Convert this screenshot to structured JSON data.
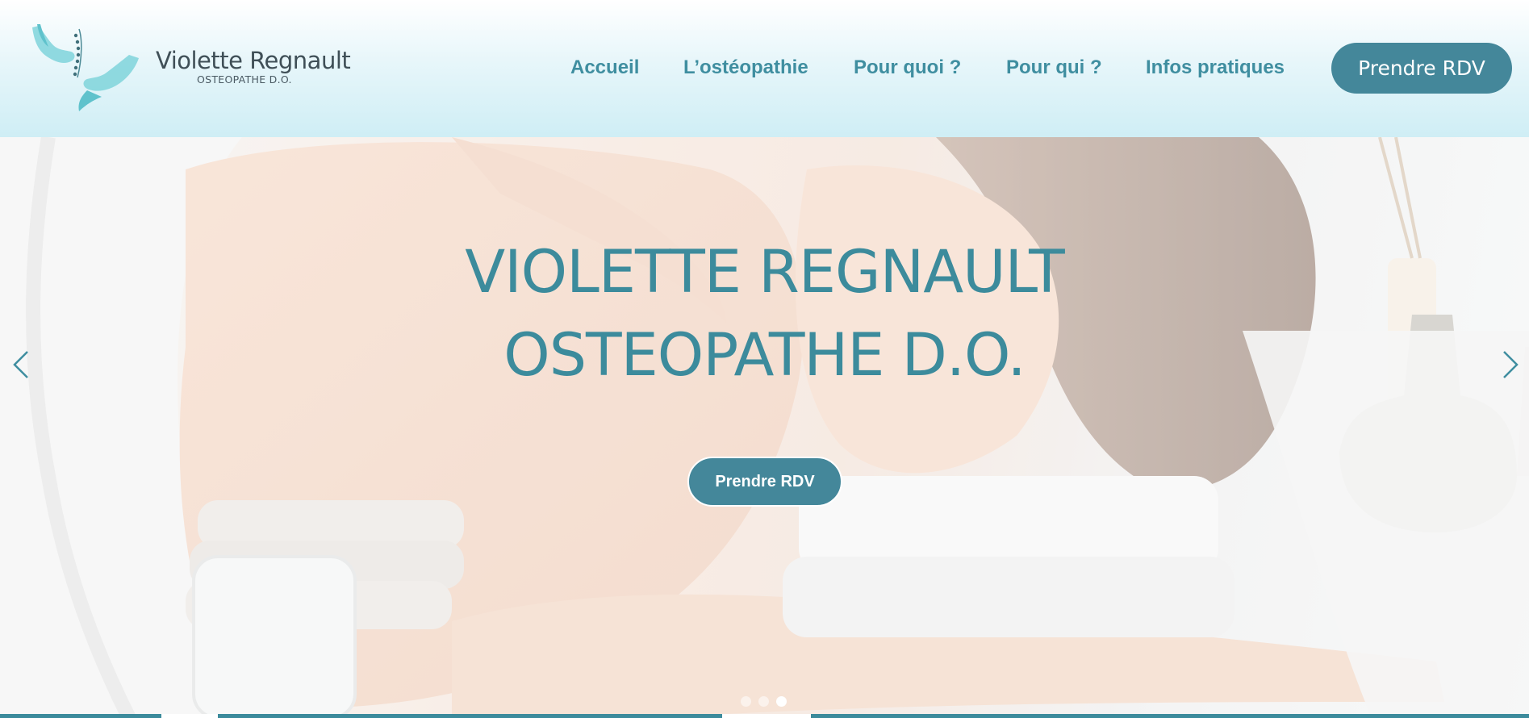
{
  "brand": {
    "name": "Violette Regnault",
    "subtitle": "OSTEOPATHE D.O."
  },
  "nav": {
    "items": [
      {
        "label": "Accueil"
      },
      {
        "label": "L’ostéopathie"
      },
      {
        "label": "Pour quoi ?"
      },
      {
        "label": "Pour qui ?"
      },
      {
        "label": "Infos pratiques"
      }
    ],
    "cta_label": "Prendre RDV"
  },
  "hero": {
    "title_line1": "VIOLETTE REGNAULT",
    "title_line2": "OSTEOPATHE D.O.",
    "button_label": "Prendre RDV",
    "slides_total": 3,
    "active_slide": 3
  },
  "icons": {
    "prev": "chevron-left-icon",
    "next": "chevron-right-icon",
    "logo": "hands-spine-logo-icon"
  },
  "colors": {
    "accent": "#44879a",
    "nav_text": "#3f8ea0",
    "title_text": "#3c8b9c",
    "logo_teal": "#5fc2cc"
  }
}
